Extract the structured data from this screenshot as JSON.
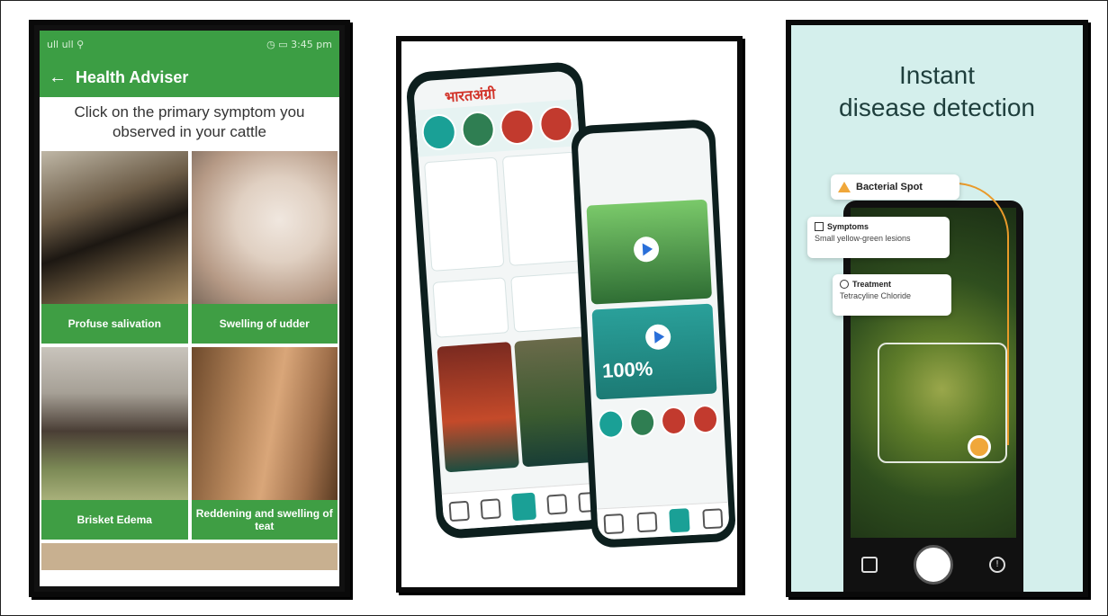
{
  "panel1": {
    "status_left": "ull ull ⚲",
    "status_right": "◷ ▭ 3:45 pm",
    "title": "Health Adviser",
    "instruction": "Click on the primary symptom you observed in your cattle",
    "tiles": [
      {
        "label": "Profuse salivation"
      },
      {
        "label": "Swelling of udder"
      },
      {
        "label": "Brisket Edema"
      },
      {
        "label": "Reddening and swelling of teat"
      }
    ],
    "colors": {
      "primary": "#3c9e44"
    }
  },
  "panel2": {
    "brand": "भारतअंग्री",
    "percent": "100%"
  },
  "panel3": {
    "headline_line1": "Instant",
    "headline_line2": "disease detection",
    "label_disease": "Bacterial Spot",
    "symptoms_title": "Symptoms",
    "symptoms_text": "Small yellow-green lesions",
    "treatment_title": "Treatment",
    "treatment_text": "Tetracyline Chloride",
    "colors": {
      "bg": "#d4efec",
      "accent": "#f0a73a"
    }
  }
}
